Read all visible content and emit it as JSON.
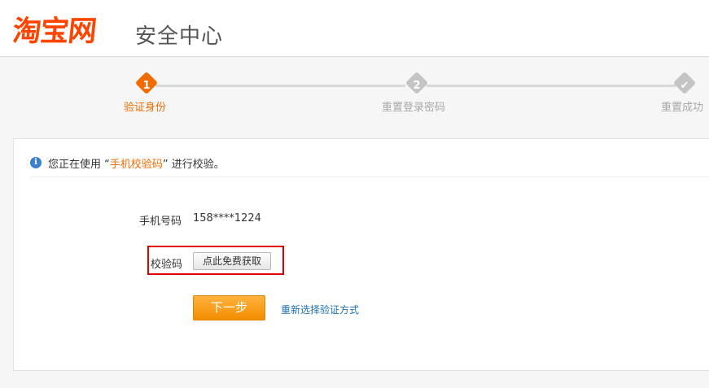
{
  "header": {
    "logo_text": "淘宝网",
    "site_title": "安全中心"
  },
  "steps": [
    {
      "number": "1",
      "label": "验证身份",
      "state": "active"
    },
    {
      "number": "2",
      "label": "重置登录密码",
      "state": "pending"
    },
    {
      "number": "✔",
      "label": "重置成功",
      "state": "pending"
    }
  ],
  "colors": {
    "brand": "#ff4400",
    "accent": "#f16c00",
    "step_inactive": "#c4c4c4",
    "link": "#1a6fb3",
    "highlight_border": "#e00000"
  },
  "notice": {
    "icon": "info-icon",
    "prefix": "您正在使用",
    "open_quote": "“",
    "method": "手机校验码",
    "close_quote": "”",
    "suffix": " 进行校验。"
  },
  "form": {
    "phone_label": "手机号码",
    "phone_value": "158****1224",
    "code_label": "校验码",
    "get_code_button": "点此免费获取",
    "next_button": "下一步",
    "reselect_link": "重新选择验证方式"
  }
}
